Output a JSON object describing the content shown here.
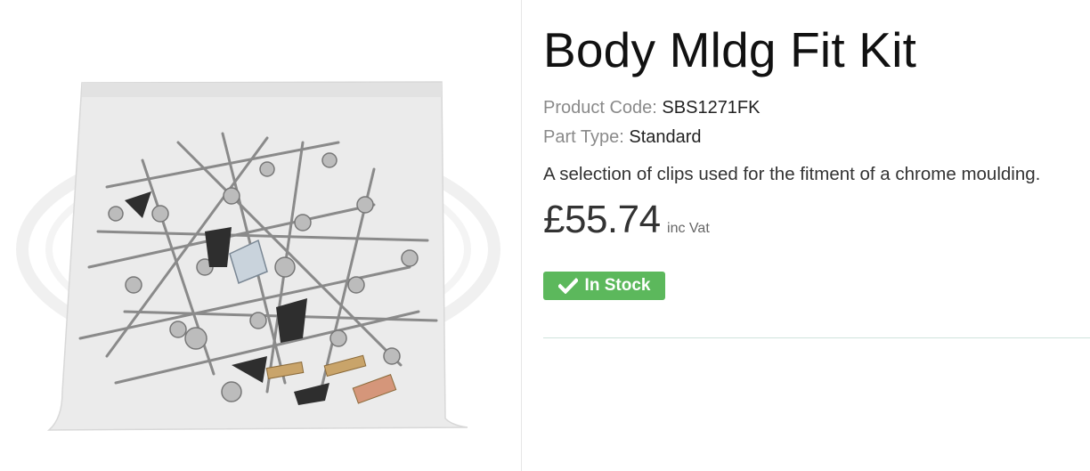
{
  "product": {
    "title": "Body Mldg Fit Kit",
    "code_label": "Product Code:",
    "code": "SBS1271FK",
    "type_label": "Part Type:",
    "type": "Standard",
    "description": "A selection of clips used for the fitment of a chrome moulding.",
    "price": "£55.74",
    "price_suffix": "inc Vat",
    "stock_label": "In Stock",
    "stock_icon": "check-icon"
  },
  "colors": {
    "stock_badge": "#5cb85c",
    "divider": "#cfe3dc"
  }
}
